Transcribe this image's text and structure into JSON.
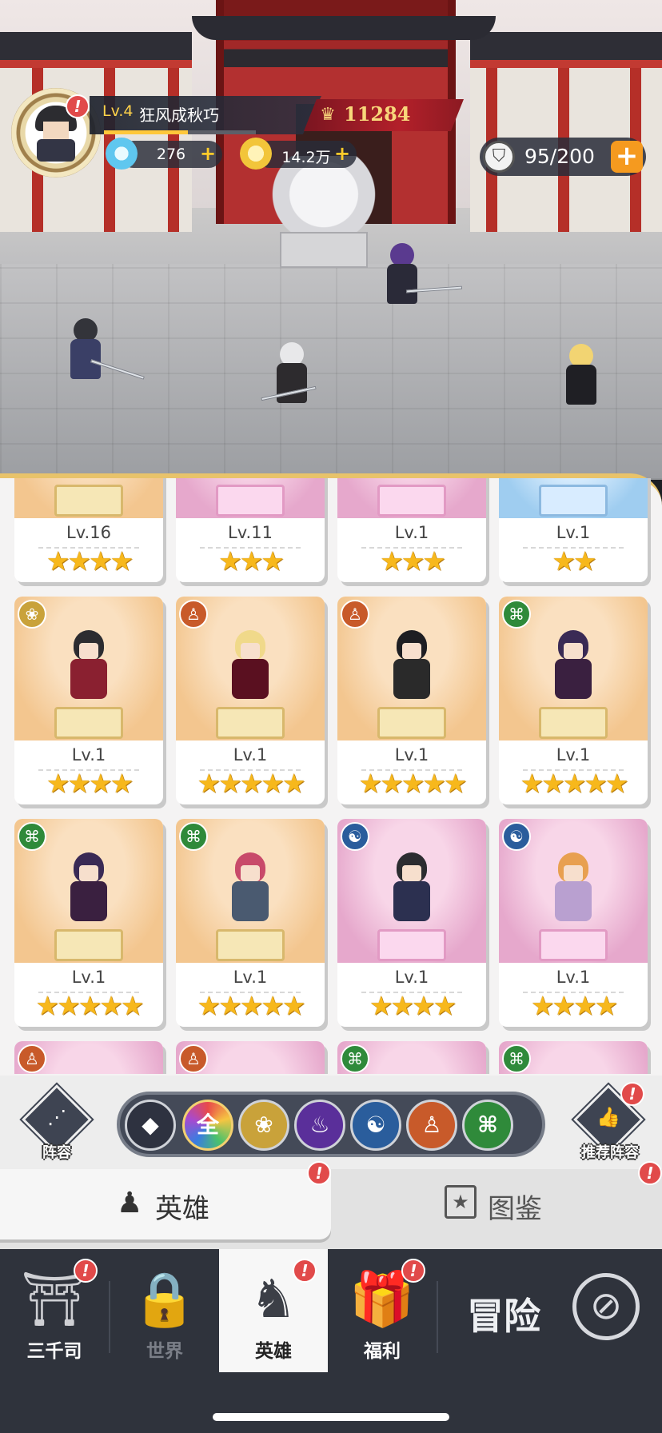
{
  "player": {
    "level": "Lv.4",
    "name": "狂风成秋巧",
    "power": "11284",
    "xp_fraction": 0.55
  },
  "resources": {
    "diamonds": "276",
    "gold": "14.2万",
    "plus": "+",
    "stamina": "95/200"
  },
  "alert_mark": "!",
  "heroes": [
    {
      "level": "Lv.16",
      "stars": "★★★★",
      "theme": "gold",
      "faction": ""
    },
    {
      "level": "Lv.11",
      "stars": "★★★",
      "theme": "pink",
      "faction": ""
    },
    {
      "level": "Lv.1",
      "stars": "★★★",
      "theme": "pink",
      "faction": ""
    },
    {
      "level": "Lv.1",
      "stars": "★★",
      "theme": "blue",
      "faction": ""
    },
    {
      "level": "Lv.1",
      "stars": "★★★★",
      "theme": "gold",
      "faction": "lotus"
    },
    {
      "level": "Lv.1",
      "stars": "★★★★★",
      "theme": "gold",
      "faction": "flame-meditation"
    },
    {
      "level": "Lv.1",
      "stars": "★★★★★",
      "theme": "gold",
      "faction": "flame-meditation"
    },
    {
      "level": "Lv.1",
      "stars": "★★★★★",
      "theme": "gold",
      "faction": "dna"
    },
    {
      "level": "Lv.1",
      "stars": "★★★★★",
      "theme": "gold",
      "faction": "dna"
    },
    {
      "level": "Lv.1",
      "stars": "★★★★★",
      "theme": "gold",
      "faction": "dna"
    },
    {
      "level": "Lv.1",
      "stars": "★★★★",
      "theme": "pink",
      "faction": "swirl"
    },
    {
      "level": "Lv.1",
      "stars": "★★★★",
      "theme": "pink",
      "faction": "swirl"
    },
    {
      "level": "",
      "stars": "",
      "theme": "pink",
      "faction": "flame-meditation"
    },
    {
      "level": "",
      "stars": "",
      "theme": "pink",
      "faction": "flame-meditation"
    },
    {
      "level": "",
      "stars": "",
      "theme": "pink",
      "faction": "dna"
    },
    {
      "level": "",
      "stars": "",
      "theme": "pink",
      "faction": "dna"
    }
  ],
  "filters": {
    "lineup_label": "阵容",
    "all_label": "全",
    "recommend_label": "推荐阵容",
    "buttons": [
      {
        "icon": "tier-icon",
        "color": "#2e3240"
      },
      {
        "icon": "all",
        "color": "#7a3bd0"
      },
      {
        "icon": "lotus-icon",
        "color": "#c9a23a"
      },
      {
        "icon": "purple-flame-icon",
        "color": "#5a2f9a"
      },
      {
        "icon": "swirl-icon",
        "color": "#2a5d9c"
      },
      {
        "icon": "meditation-icon",
        "color": "#c85a2a"
      },
      {
        "icon": "dna-icon",
        "color": "#2f8a3a"
      }
    ]
  },
  "tabs": {
    "heroes": "英雄",
    "codex": "图鉴"
  },
  "nav": {
    "sanqiansi": "三千司",
    "world": "世界",
    "heroes": "英雄",
    "welfare": "福利",
    "adventure": "冒险"
  },
  "colors": {
    "accent_gold": "#ffc83a",
    "alert_red": "#e14a4a",
    "star_yellow": "#f7b81c",
    "stamina_plus": "#f59a1f"
  }
}
